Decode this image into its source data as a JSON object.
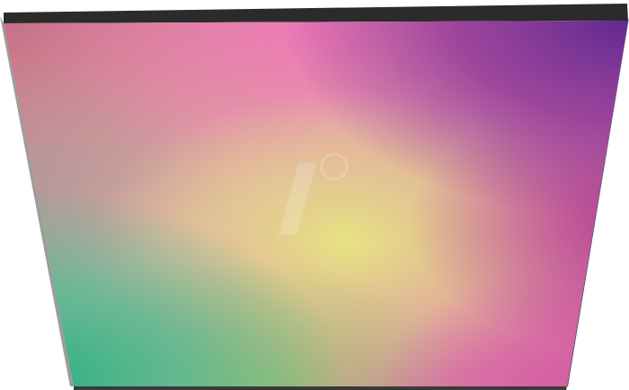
{
  "panel": {
    "description_colors": {
      "edge": "#2b2b2b",
      "top_left": "#c46a86",
      "top_center": "#f077b8",
      "top_right": "#6a2c94",
      "right_middle": "#b33a93",
      "center": "#e2dc86",
      "bottom_left": "#1bb57f",
      "bottom_center": "#9bc86a",
      "bottom_right": "#d86aa6"
    },
    "watermark": {
      "icon_name": "reichelt-logo-watermark-icon"
    }
  }
}
